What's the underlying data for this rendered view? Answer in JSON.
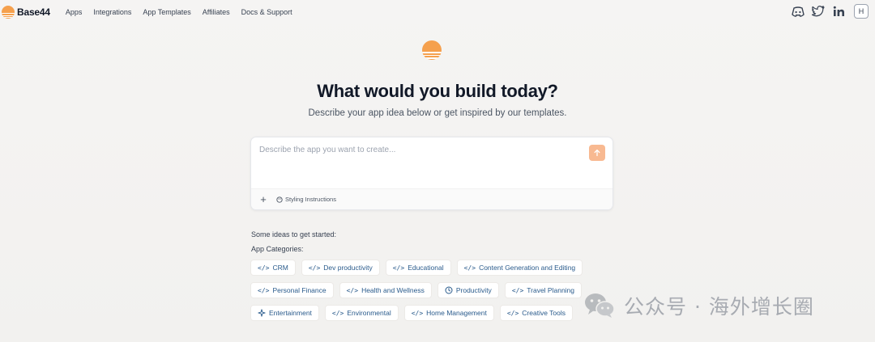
{
  "brand": {
    "name": "Base44",
    "accent": "#f5a04d"
  },
  "nav": [
    {
      "label": "Apps"
    },
    {
      "label": "Integrations"
    },
    {
      "label": "App Templates"
    },
    {
      "label": "Affiliates"
    },
    {
      "label": "Docs & Support"
    }
  ],
  "socials": [
    "discord-icon",
    "twitter-icon",
    "linkedin-icon"
  ],
  "user": {
    "initial": "H"
  },
  "hero": {
    "title": "What would you build today?",
    "subtitle": "Describe your app idea below or get inspired by our templates."
  },
  "prompt": {
    "placeholder": "Describe the app you want to create...",
    "send_icon": "arrow-up-icon",
    "add_label": "+",
    "styling_label": "Styling Instructions"
  },
  "ideas": {
    "label": "Some ideas to get started:",
    "categories_label": "App Categories:",
    "rows": [
      [
        {
          "icon": "</>",
          "label": "CRM"
        },
        {
          "icon": "</>",
          "label": "Dev productivity"
        },
        {
          "icon": "</>",
          "label": "Educational"
        },
        {
          "icon": "</>",
          "label": "Content Generation and Editing"
        }
      ],
      [
        {
          "icon": "</>",
          "label": "Personal Finance"
        },
        {
          "icon": "</>",
          "label": "Health and Wellness"
        },
        {
          "icon": "clock",
          "label": "Productivity"
        },
        {
          "icon": "</>",
          "label": "Travel Planning"
        }
      ],
      [
        {
          "icon": "sparkle",
          "label": "Entertainment"
        },
        {
          "icon": "</>",
          "label": "Environmental"
        },
        {
          "icon": "</>",
          "label": "Home Management"
        },
        {
          "icon": "</>",
          "label": "Creative Tools"
        }
      ]
    ]
  },
  "watermark": {
    "text": "公众号 · 海外增长圈"
  }
}
